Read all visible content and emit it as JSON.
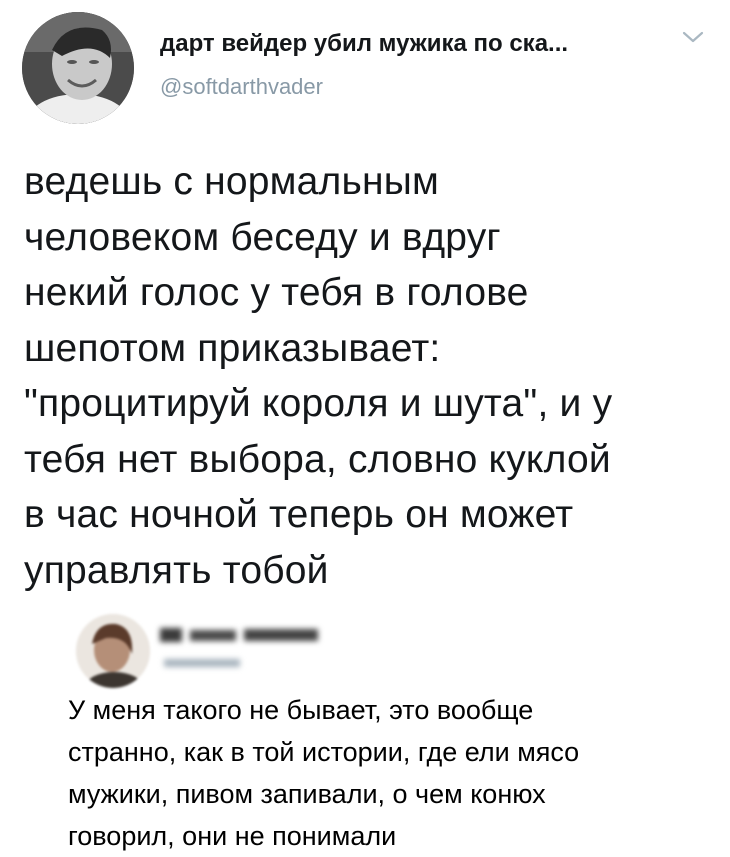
{
  "tweet": {
    "author": {
      "display_name": "дарт вейдер убил мужика по ска...",
      "handle": "@softdarthvader",
      "avatar_icon": "profile-photo-smiling-man",
      "menu_icon": "chevron-down-icon"
    },
    "text_lines": [
      "ведешь с нормальным",
      "человеком беседу и вдруг",
      "некий голос у тебя в голове",
      "шепотом приказывает:",
      "\"процитируй короля и шута\", и у",
      "тебя нет выбора, словно куклой",
      "в час ночной теперь он может",
      "управлять тобой"
    ]
  },
  "quoted_post": {
    "author_blurred": true,
    "avatar_icon": "blurred-profile-photo",
    "text_lines": [
      "У меня такого не бывает, это вообще",
      "странно, как в той истории, где ели мясо",
      "мужики, пивом запивали, о чем конюх",
      "говорил, они не понимали"
    ]
  },
  "colors": {
    "text": "#14171a",
    "handle": "#8899a6",
    "chevron": "#aab8c2",
    "background": "#ffffff"
  }
}
